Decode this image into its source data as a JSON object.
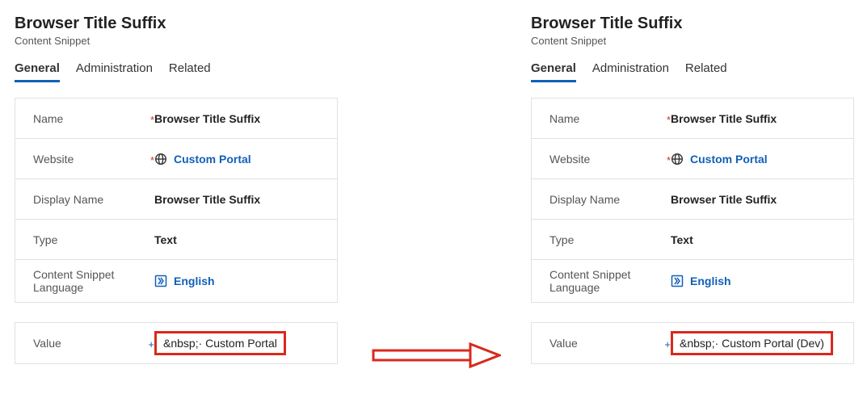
{
  "left": {
    "title": "Browser Title Suffix",
    "subtitle": "Content Snippet",
    "tabs": {
      "general": "General",
      "administration": "Administration",
      "related": "Related"
    },
    "fields": {
      "name_label": "Name",
      "name_value": "Browser Title Suffix",
      "website_label": "Website",
      "website_value": "Custom Portal",
      "display_name_label": "Display Name",
      "display_name_value": "Browser Title Suffix",
      "type_label": "Type",
      "type_value": "Text",
      "lang_label": "Content Snippet Language",
      "lang_value": "English",
      "value_label": "Value",
      "value_value": "&nbsp;· Custom Portal"
    }
  },
  "right": {
    "title": "Browser Title Suffix",
    "subtitle": "Content Snippet",
    "tabs": {
      "general": "General",
      "administration": "Administration",
      "related": "Related"
    },
    "fields": {
      "name_label": "Name",
      "name_value": "Browser Title Suffix",
      "website_label": "Website",
      "website_value": "Custom Portal",
      "display_name_label": "Display Name",
      "display_name_value": "Browser Title Suffix",
      "type_label": "Type",
      "type_value": "Text",
      "lang_label": "Content Snippet Language",
      "lang_value": "English",
      "value_label": "Value",
      "value_value": "&nbsp;· Custom Portal (Dev)"
    }
  },
  "marks": {
    "required": "*",
    "recommended": "+"
  }
}
